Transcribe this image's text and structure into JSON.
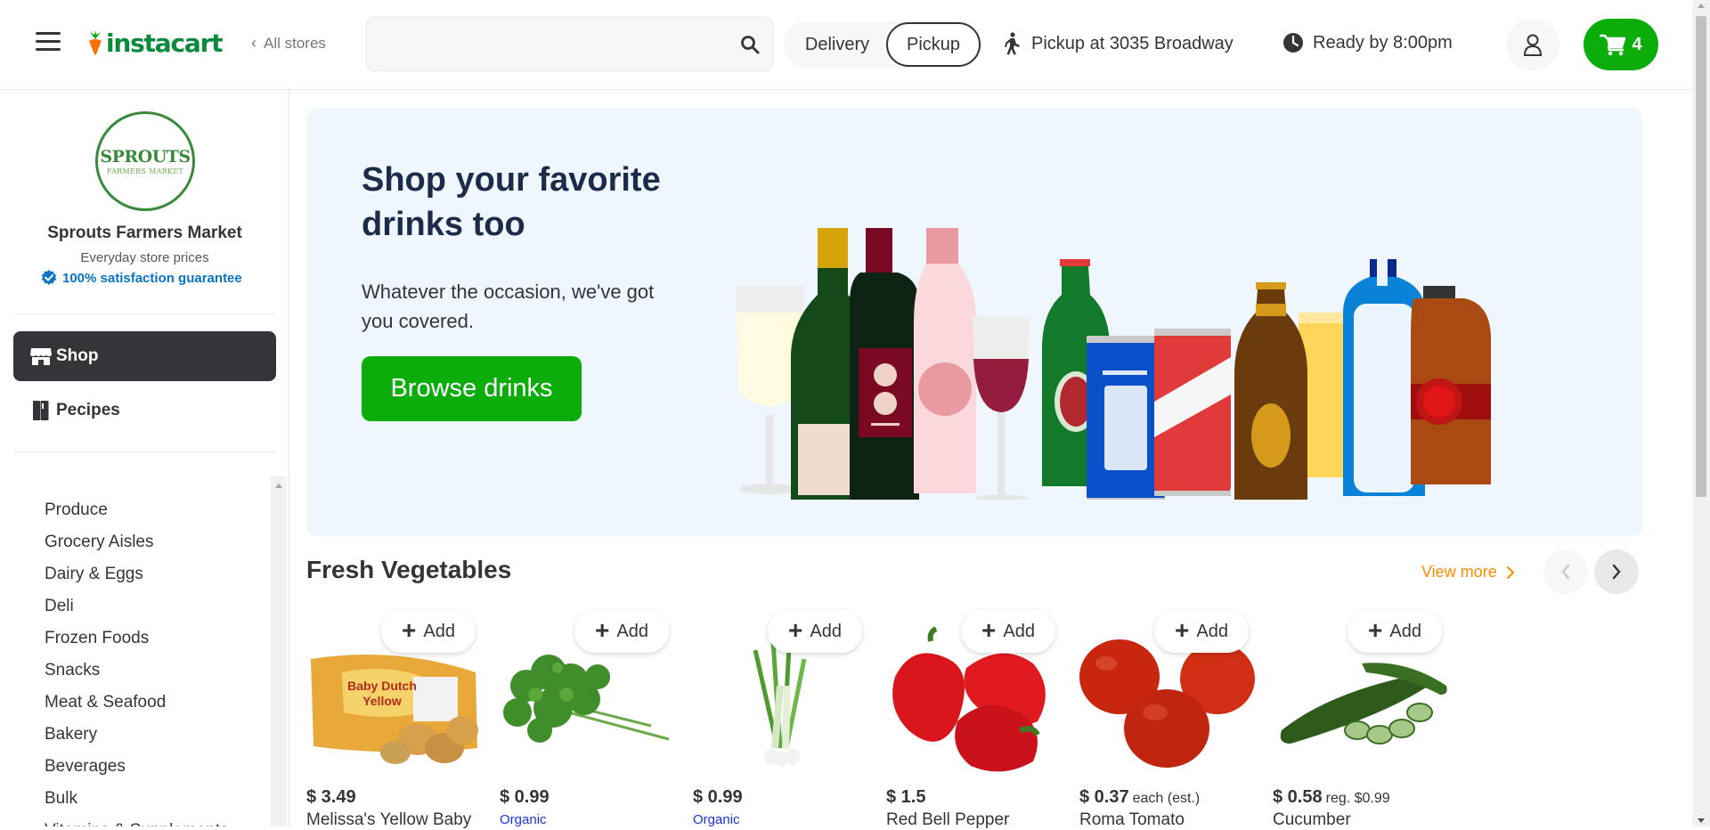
{
  "header": {
    "logo_text": "instacart",
    "all_stores": "All stores",
    "search_placeholder": "",
    "mode": {
      "delivery": "Delivery",
      "pickup": "Pickup",
      "selected": "pickup"
    },
    "pickup_location": "Pickup at 3035 Broadway",
    "ready_by": "Ready by 8:00pm",
    "cart_count": "4",
    "brand_green": "#0aad0a"
  },
  "sidebar": {
    "store_logo_text": "SPROUTS",
    "store_logo_sub": "FARMERS MARKET",
    "store_name": "Sprouts Farmers Market",
    "store_sub": "Everyday store prices",
    "guarantee": "100% satisfaction guarantee",
    "nav": [
      {
        "label": "Shop",
        "icon": "storefront-icon",
        "active": true
      },
      {
        "label": "Pecipes",
        "icon": "recipe-book-icon",
        "active": false
      }
    ],
    "categories": [
      "Produce",
      "Grocery Aisles",
      "Dairy & Eggs",
      "Deli",
      "Frozen Foods",
      "Snacks",
      "Meat & Seafood",
      "Bakery",
      "Beverages",
      "Bulk",
      "Vitamins & Supplements"
    ]
  },
  "banner": {
    "title": "Shop your favorite drinks too",
    "subtitle": "Whatever the occasion, we've got you covered.",
    "button": "Browse drinks"
  },
  "section": {
    "title": "Fresh Vegetables",
    "view_more": "View more",
    "add_label": "Add",
    "products": [
      {
        "price": "$ 3.49",
        "extra": "",
        "name": "Melissa's Yellow Baby",
        "tag": "",
        "image": "potatoes"
      },
      {
        "price": "$ 0.99",
        "extra": "",
        "name": "",
        "tag": "Organic",
        "image": "cilantro"
      },
      {
        "price": "$ 0.99",
        "extra": "",
        "name": "",
        "tag": "Organic",
        "image": "green-onion"
      },
      {
        "price": "$ 1.5",
        "extra": "",
        "name": "Red Bell Pepper",
        "tag": "",
        "image": "red-pepper"
      },
      {
        "price": "$ 0.37",
        "extra": "each (est.)",
        "name": "Roma Tomato",
        "tag": "",
        "image": "tomato"
      },
      {
        "price": "$ 0.58",
        "extra": "reg. $0.99",
        "name": "Cucumber",
        "tag": "",
        "image": "cucumber"
      }
    ]
  }
}
